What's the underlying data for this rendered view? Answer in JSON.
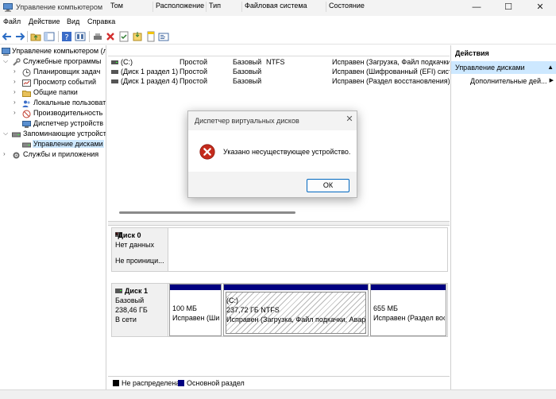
{
  "window": {
    "title": "Управление компьютером",
    "minimize_glyph": "—",
    "maximize_glyph": "☐",
    "close_glyph": "✕"
  },
  "menu": [
    "Файл",
    "Действие",
    "Вид",
    "Справка"
  ],
  "toolbar_icons": [
    "back-arrow-icon",
    "forward-arrow-icon",
    "folder-up-icon",
    "show-hide-tree-icon",
    "help-icon",
    "view-icon",
    "connect-icon",
    "delete-icon",
    "properties-icon",
    "rescan-icon",
    "new-icon",
    "info-icon"
  ],
  "tree": {
    "root": "Управление компьютером (л",
    "system_tools": "Служебные программы",
    "task_scheduler": "Планировщик задач",
    "event_viewer": "Просмотр событий",
    "shared_folders": "Общие папки",
    "local_users": "Локальные пользовате",
    "performance": "Производительность",
    "device_manager": "Диспетчер устройств",
    "storage": "Запоминающие устройст",
    "disk_management": "Управление дисками",
    "services": "Службы и приложения"
  },
  "volume_list": {
    "columns": [
      "Том",
      "Расположение",
      "Тип",
      "Файловая система",
      "Состояние"
    ],
    "rows": [
      {
        "volume": "(C:)",
        "layout": "Простой",
        "type": "Базовый",
        "fs": "NTFS",
        "status": "Исправен (Загрузка, Файл подкачки, Ав"
      },
      {
        "volume": "(Диск 1 раздел 1)",
        "layout": "Простой",
        "type": "Базовый",
        "fs": "",
        "status": "Исправен (Шифрованный (EFI) систе"
      },
      {
        "volume": "(Диск 1 раздел 4)",
        "layout": "Простой",
        "type": "Базовый",
        "fs": "",
        "status": "Исправен (Раздел восстановления)"
      }
    ]
  },
  "disks": {
    "disk0": {
      "name": "*Диск 0",
      "line2": "Нет данных",
      "line3": "Не проиници..."
    },
    "disk1": {
      "name": "Диск 1",
      "type": "Базовый",
      "size": "238,46 ГБ",
      "state": "В сети",
      "partitions": [
        {
          "title": "",
          "size": "100 МБ",
          "status": "Исправен (Ши"
        },
        {
          "title": "(C:)",
          "size": "237,72 ГБ NTFS",
          "status": "Исправен (Загрузка, Файл подкачки, Аварі"
        },
        {
          "title": "",
          "size": "655 МБ",
          "status": "Исправен (Раздел вос"
        }
      ]
    }
  },
  "legend": {
    "unallocated": "Не распределена",
    "primary": "Основной раздел",
    "unallocated_color": "#000000",
    "primary_color": "#000080"
  },
  "actions": {
    "title": "Действия",
    "section": "Управление дисками",
    "more": "Дополнительные дей...",
    "more_arrow": "▶"
  },
  "dialog": {
    "title": "Диспетчер виртуальных дисков",
    "message": "Указано несуществующее устройство.",
    "ok": "ОК",
    "icon": "error-icon"
  },
  "colors": {
    "accent": "#0067c0",
    "selection": "#cde8ff",
    "error": "#c42b1c"
  }
}
